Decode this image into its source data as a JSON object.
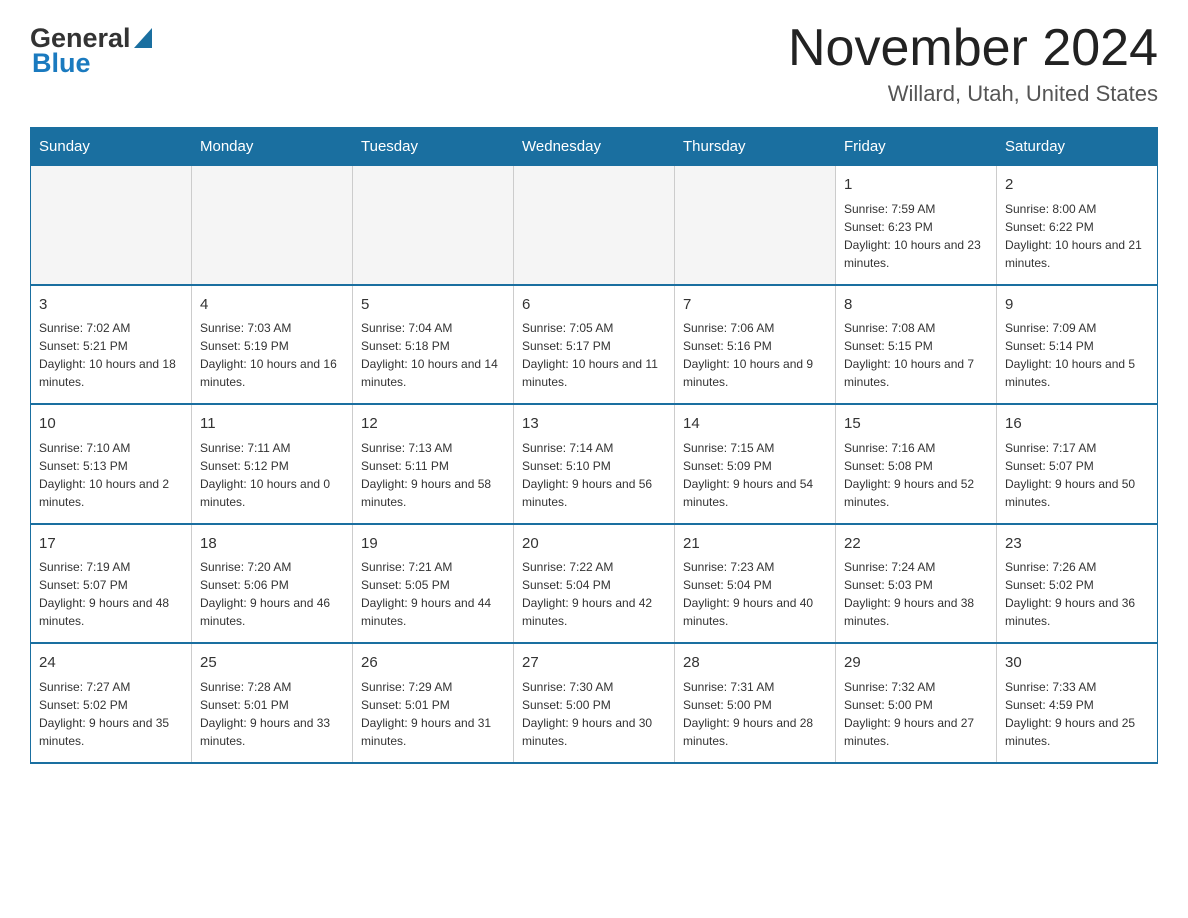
{
  "logo": {
    "general": "General",
    "blue": "Blue"
  },
  "title": {
    "month": "November 2024",
    "location": "Willard, Utah, United States"
  },
  "weekdays": [
    "Sunday",
    "Monday",
    "Tuesday",
    "Wednesday",
    "Thursday",
    "Friday",
    "Saturday"
  ],
  "weeks": [
    [
      {
        "day": "",
        "info": "",
        "empty": true
      },
      {
        "day": "",
        "info": "",
        "empty": true
      },
      {
        "day": "",
        "info": "",
        "empty": true
      },
      {
        "day": "",
        "info": "",
        "empty": true
      },
      {
        "day": "",
        "info": "",
        "empty": true
      },
      {
        "day": "1",
        "info": "Sunrise: 7:59 AM\nSunset: 6:23 PM\nDaylight: 10 hours and 23 minutes.",
        "empty": false
      },
      {
        "day": "2",
        "info": "Sunrise: 8:00 AM\nSunset: 6:22 PM\nDaylight: 10 hours and 21 minutes.",
        "empty": false
      }
    ],
    [
      {
        "day": "3",
        "info": "Sunrise: 7:02 AM\nSunset: 5:21 PM\nDaylight: 10 hours and 18 minutes.",
        "empty": false
      },
      {
        "day": "4",
        "info": "Sunrise: 7:03 AM\nSunset: 5:19 PM\nDaylight: 10 hours and 16 minutes.",
        "empty": false
      },
      {
        "day": "5",
        "info": "Sunrise: 7:04 AM\nSunset: 5:18 PM\nDaylight: 10 hours and 14 minutes.",
        "empty": false
      },
      {
        "day": "6",
        "info": "Sunrise: 7:05 AM\nSunset: 5:17 PM\nDaylight: 10 hours and 11 minutes.",
        "empty": false
      },
      {
        "day": "7",
        "info": "Sunrise: 7:06 AM\nSunset: 5:16 PM\nDaylight: 10 hours and 9 minutes.",
        "empty": false
      },
      {
        "day": "8",
        "info": "Sunrise: 7:08 AM\nSunset: 5:15 PM\nDaylight: 10 hours and 7 minutes.",
        "empty": false
      },
      {
        "day": "9",
        "info": "Sunrise: 7:09 AM\nSunset: 5:14 PM\nDaylight: 10 hours and 5 minutes.",
        "empty": false
      }
    ],
    [
      {
        "day": "10",
        "info": "Sunrise: 7:10 AM\nSunset: 5:13 PM\nDaylight: 10 hours and 2 minutes.",
        "empty": false
      },
      {
        "day": "11",
        "info": "Sunrise: 7:11 AM\nSunset: 5:12 PM\nDaylight: 10 hours and 0 minutes.",
        "empty": false
      },
      {
        "day": "12",
        "info": "Sunrise: 7:13 AM\nSunset: 5:11 PM\nDaylight: 9 hours and 58 minutes.",
        "empty": false
      },
      {
        "day": "13",
        "info": "Sunrise: 7:14 AM\nSunset: 5:10 PM\nDaylight: 9 hours and 56 minutes.",
        "empty": false
      },
      {
        "day": "14",
        "info": "Sunrise: 7:15 AM\nSunset: 5:09 PM\nDaylight: 9 hours and 54 minutes.",
        "empty": false
      },
      {
        "day": "15",
        "info": "Sunrise: 7:16 AM\nSunset: 5:08 PM\nDaylight: 9 hours and 52 minutes.",
        "empty": false
      },
      {
        "day": "16",
        "info": "Sunrise: 7:17 AM\nSunset: 5:07 PM\nDaylight: 9 hours and 50 minutes.",
        "empty": false
      }
    ],
    [
      {
        "day": "17",
        "info": "Sunrise: 7:19 AM\nSunset: 5:07 PM\nDaylight: 9 hours and 48 minutes.",
        "empty": false
      },
      {
        "day": "18",
        "info": "Sunrise: 7:20 AM\nSunset: 5:06 PM\nDaylight: 9 hours and 46 minutes.",
        "empty": false
      },
      {
        "day": "19",
        "info": "Sunrise: 7:21 AM\nSunset: 5:05 PM\nDaylight: 9 hours and 44 minutes.",
        "empty": false
      },
      {
        "day": "20",
        "info": "Sunrise: 7:22 AM\nSunset: 5:04 PM\nDaylight: 9 hours and 42 minutes.",
        "empty": false
      },
      {
        "day": "21",
        "info": "Sunrise: 7:23 AM\nSunset: 5:04 PM\nDaylight: 9 hours and 40 minutes.",
        "empty": false
      },
      {
        "day": "22",
        "info": "Sunrise: 7:24 AM\nSunset: 5:03 PM\nDaylight: 9 hours and 38 minutes.",
        "empty": false
      },
      {
        "day": "23",
        "info": "Sunrise: 7:26 AM\nSunset: 5:02 PM\nDaylight: 9 hours and 36 minutes.",
        "empty": false
      }
    ],
    [
      {
        "day": "24",
        "info": "Sunrise: 7:27 AM\nSunset: 5:02 PM\nDaylight: 9 hours and 35 minutes.",
        "empty": false
      },
      {
        "day": "25",
        "info": "Sunrise: 7:28 AM\nSunset: 5:01 PM\nDaylight: 9 hours and 33 minutes.",
        "empty": false
      },
      {
        "day": "26",
        "info": "Sunrise: 7:29 AM\nSunset: 5:01 PM\nDaylight: 9 hours and 31 minutes.",
        "empty": false
      },
      {
        "day": "27",
        "info": "Sunrise: 7:30 AM\nSunset: 5:00 PM\nDaylight: 9 hours and 30 minutes.",
        "empty": false
      },
      {
        "day": "28",
        "info": "Sunrise: 7:31 AM\nSunset: 5:00 PM\nDaylight: 9 hours and 28 minutes.",
        "empty": false
      },
      {
        "day": "29",
        "info": "Sunrise: 7:32 AM\nSunset: 5:00 PM\nDaylight: 9 hours and 27 minutes.",
        "empty": false
      },
      {
        "day": "30",
        "info": "Sunrise: 7:33 AM\nSunset: 4:59 PM\nDaylight: 9 hours and 25 minutes.",
        "empty": false
      }
    ]
  ]
}
